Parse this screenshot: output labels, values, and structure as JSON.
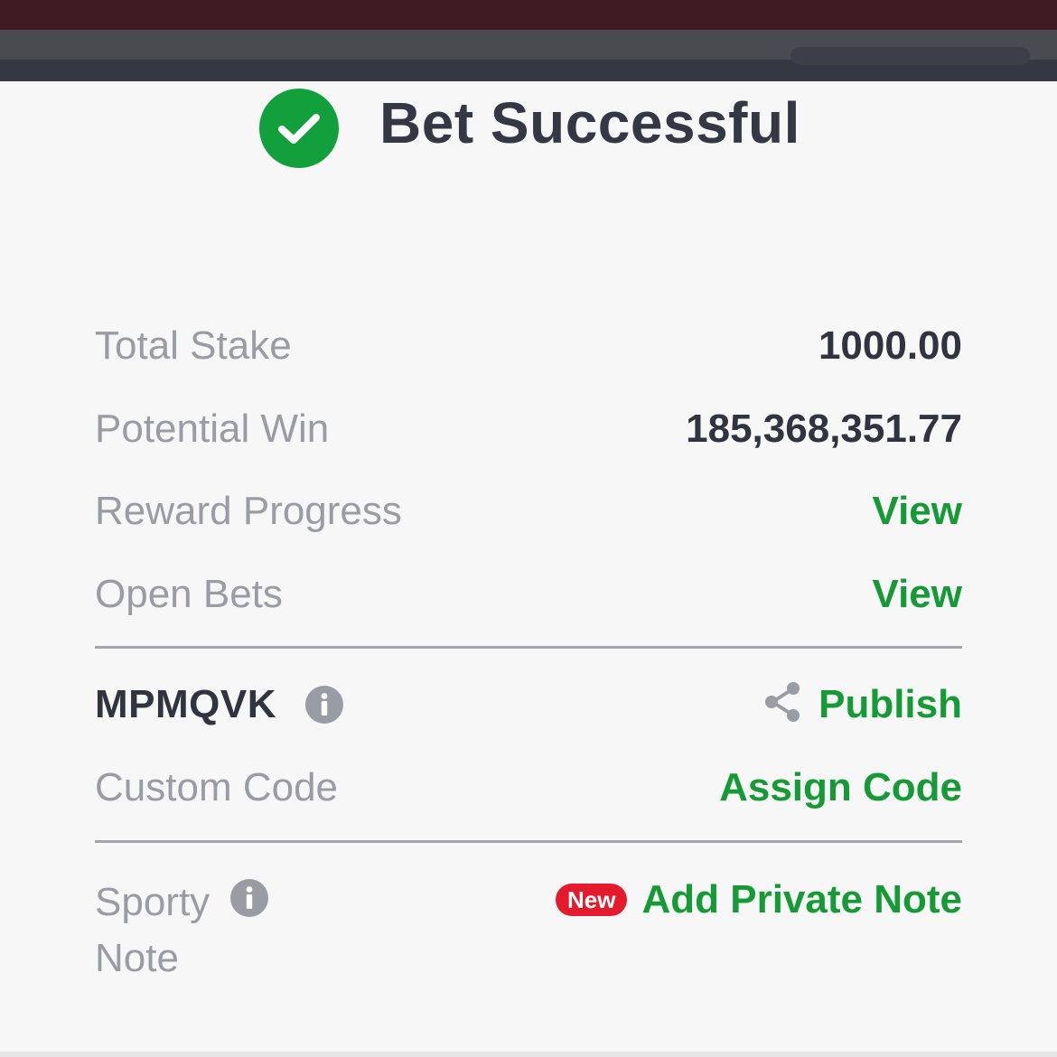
{
  "header": {
    "title": "Bet Successful",
    "icon": "check-circle-icon",
    "success_color": "#12a03c"
  },
  "summary": {
    "total_stake_label": "Total Stake",
    "total_stake_value": "1000.00",
    "potential_win_label": "Potential Win",
    "potential_win_value": "185,368,351.77",
    "reward_progress_label": "Reward Progress",
    "reward_progress_action": "View",
    "open_bets_label": "Open Bets",
    "open_bets_action": "View"
  },
  "booking": {
    "code": "MPMQVK",
    "publish_label": "Publish",
    "custom_code_label": "Custom Code",
    "assign_code_label": "Assign Code"
  },
  "note": {
    "label": "Sporty Note",
    "badge": "New",
    "action": "Add Private Note"
  },
  "colors": {
    "accent_green": "#169a36",
    "badge_red": "#e31b2d",
    "text_dark": "#303440",
    "text_muted": "#9a9ca5"
  }
}
